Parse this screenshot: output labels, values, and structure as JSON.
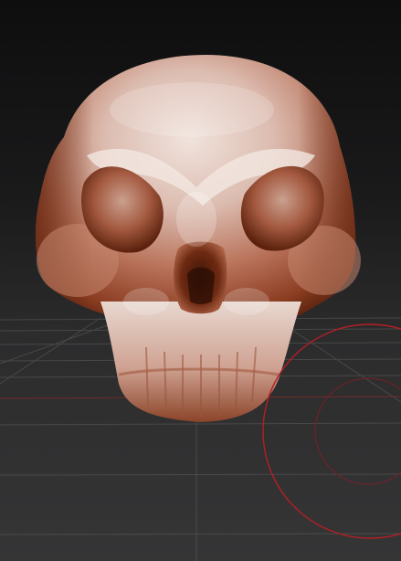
{
  "viewport": {
    "kind": "3d-sculpting-viewport",
    "contents": "skull-model",
    "tool": "brush-cursor"
  },
  "colors": {
    "background_top": "#0e0e0f",
    "background_bottom": "#353536",
    "grid_line": "#5a5a5a",
    "axis_line": "#8b1f1f",
    "brush_ring": "#b31f25",
    "skull_highlight": "#eadbd4",
    "skull_midtone": "#c98e7a",
    "skull_shadow": "#6a2a14"
  }
}
